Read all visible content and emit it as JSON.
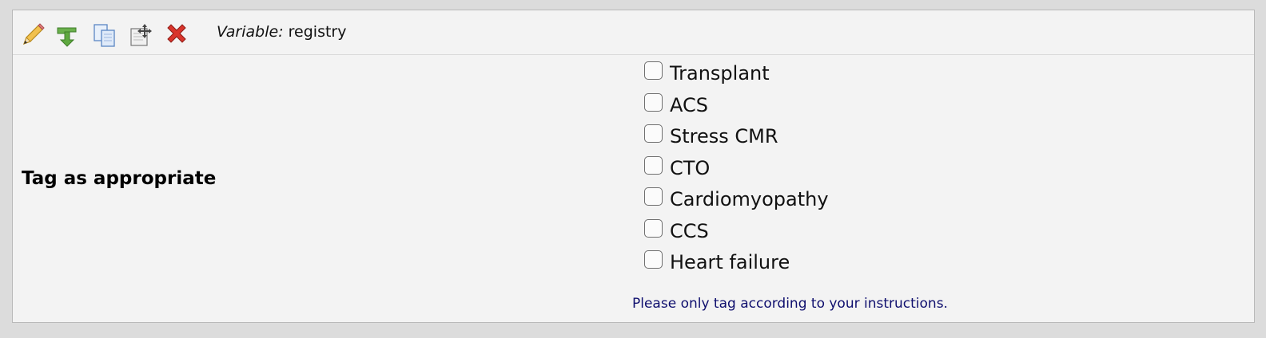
{
  "toolbar": {
    "icons": [
      "pencil-icon",
      "branch-arrow-icon",
      "copy-icon",
      "move-icon",
      "delete-icon"
    ],
    "variable_prefix": "Variable:",
    "variable_name": "registry"
  },
  "field": {
    "label": "Tag as appropriate",
    "options": [
      {
        "label": "Transplant",
        "checked": false
      },
      {
        "label": "ACS",
        "checked": false
      },
      {
        "label": "Stress CMR",
        "checked": false
      },
      {
        "label": "CTO",
        "checked": false
      },
      {
        "label": "Cardiomyopathy",
        "checked": false
      },
      {
        "label": "CCS",
        "checked": false
      },
      {
        "label": "Heart failure",
        "checked": false
      }
    ],
    "note": "Please only tag according to your instructions."
  },
  "colors": {
    "panel_background": "#f3f3f3",
    "page_background": "#dcdcdc",
    "note_text": "#0f0f6e"
  }
}
